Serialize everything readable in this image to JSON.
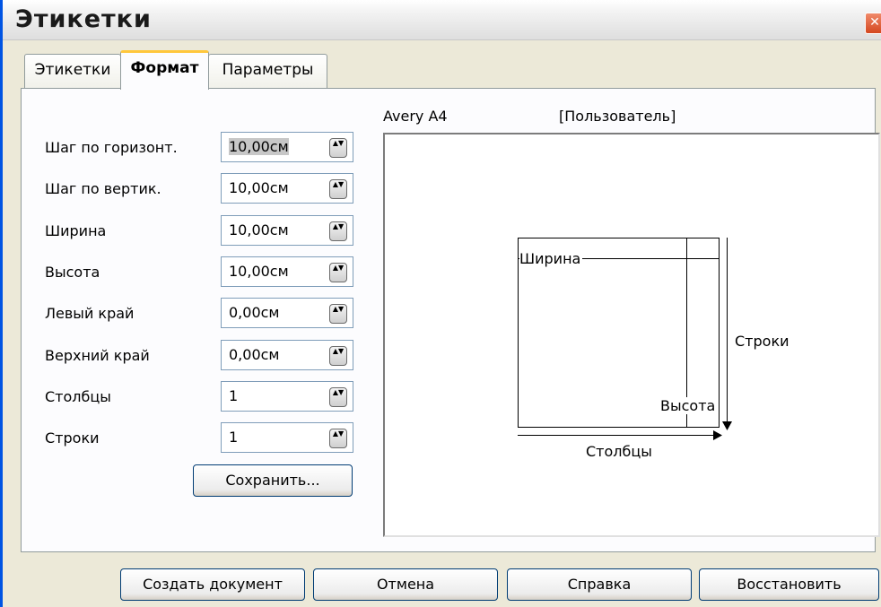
{
  "window": {
    "title": "Этикетки",
    "close_glyph": "✕"
  },
  "tabs": [
    {
      "label": "Этикетки",
      "active": false
    },
    {
      "label": "Формат",
      "active": true
    },
    {
      "label": "Параметры",
      "active": false
    }
  ],
  "fields": [
    {
      "label": "Шаг по горизонт.",
      "value": "10,00см"
    },
    {
      "label": "Шаг по вертик.",
      "value": "10,00см"
    },
    {
      "label": "Ширина",
      "value": "10,00см"
    },
    {
      "label": "Высота",
      "value": "10,00см"
    },
    {
      "label": "Левый край",
      "value": "0,00см"
    },
    {
      "label": "Верхний край",
      "value": "0,00см"
    },
    {
      "label": "Столбцы",
      "value": "1"
    },
    {
      "label": "Строки",
      "value": "1"
    }
  ],
  "save_button": "Сохранить...",
  "preview": {
    "brand": "Avery A4",
    "type": "[Пользователь]",
    "width_label": "Ширина",
    "height_label": "Высота",
    "rows_label": "Строки",
    "columns_label": "Столбцы"
  },
  "footer_buttons": {
    "create": "Создать документ",
    "cancel": "Отмена",
    "help": "Справка",
    "reset": "Восстановить"
  },
  "spin_arrows_glyph": "▲▼"
}
